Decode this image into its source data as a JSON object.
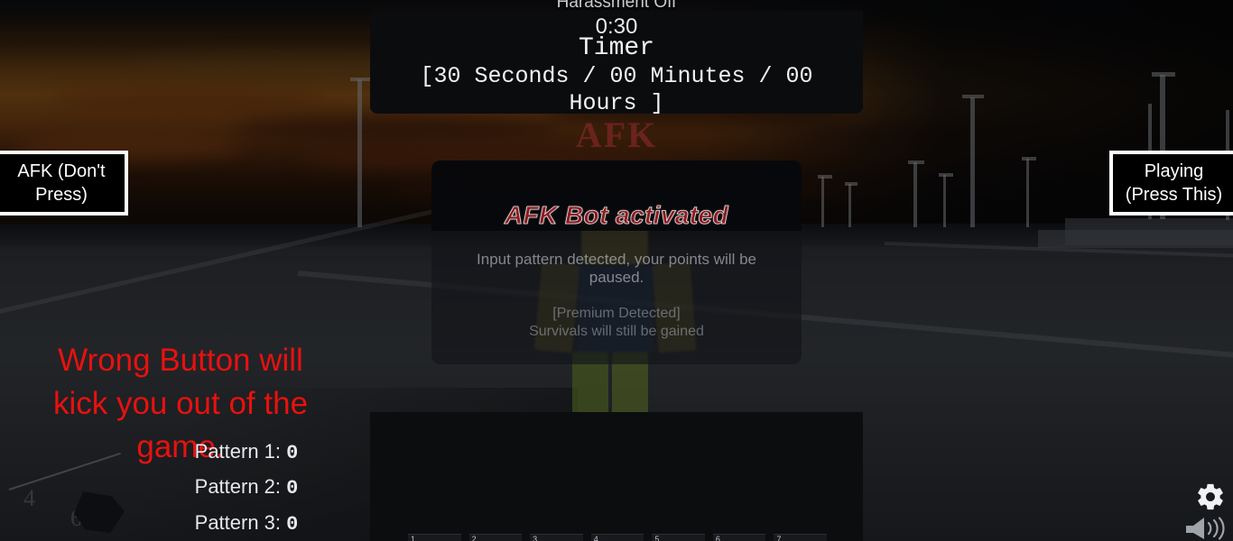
{
  "status": {
    "harassment": "Harassment Off",
    "clock": "0:30"
  },
  "timer_panel": {
    "title": "Timer",
    "detail": "[30 Seconds / 00 Minutes / 00 Hours ]"
  },
  "watermark": {
    "text": "AFK"
  },
  "afk_panel": {
    "title": "AFK Bot activated",
    "body": "Input pattern detected, your points will be paused.",
    "subtext": "[Premium Detected]\nSurvivals will still be gained",
    "title_color": "#8c1a1f"
  },
  "buttons": {
    "afk": "AFK (Don't Press)",
    "playing": "Playing (Press This)"
  },
  "warning": {
    "text": "Wrong Button will kick you out of the game.",
    "color": "#e8110f"
  },
  "patterns": {
    "rows": [
      {
        "label": "Pattern 1:",
        "value": "0"
      },
      {
        "label": "Pattern 2:",
        "value": "0"
      },
      {
        "label": "Pattern 3:",
        "value": "0"
      }
    ]
  },
  "hotbar": {
    "slots": [
      "1",
      "2",
      "3",
      "4",
      "5",
      "6",
      "7"
    ]
  },
  "icons": {
    "settings": "gear-icon",
    "volume": "speaker-volume-icon"
  },
  "scene": {
    "numerals": [
      "4",
      "6"
    ]
  }
}
